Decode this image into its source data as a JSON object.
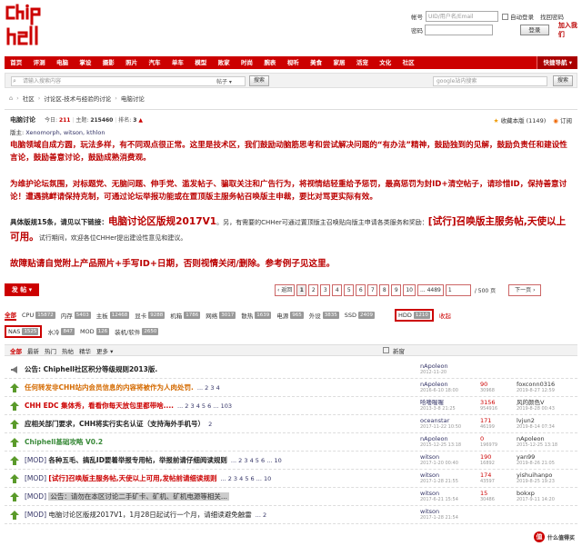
{
  "header": {
    "login": {
      "account_label": "帐号",
      "account_placeholder": "UID/用户名/Email",
      "autologin": "自动登录",
      "password_label": "密码",
      "retrieve": "找回密码",
      "login_button": "登录",
      "join": "加入我们"
    }
  },
  "nav": {
    "items": [
      "首页",
      "评测",
      "电脑",
      "掌设",
      "摄影",
      "照片",
      "汽车",
      "单车",
      "模型",
      "败家",
      "时尚",
      "腕表",
      "视听",
      "美食",
      "家居",
      "活宠",
      "文化",
      "社区"
    ],
    "quick": "快捷导航 ▾"
  },
  "search": {
    "placeholder": "请输入搜索内容",
    "type": "帖子 ▾",
    "button": "搜索",
    "google_placeholder": "google站内搜索",
    "google_button": "搜索"
  },
  "breadcrumb": [
    "社区",
    "讨论区-技术与经验的讨论",
    "电脑讨论"
  ],
  "forum": {
    "title": "电脑讨论",
    "today_label": "今日:",
    "today": "211",
    "theme_label": "主题:",
    "theme": "215460",
    "rank_label": "排名:",
    "rank": "3",
    "mods_label": "版主:",
    "mods": "Xenomorph, witson, kthlon",
    "favorite": "收藏本版 (1149)",
    "subscribe": "订阅",
    "rules": {
      "p1": "电脑领域自成方圆，玩法多样，有不同观点很正常。这里是技术区，我们鼓励动脑筋思考和尝试解决问题的“有办法”精神，鼓励独到的见解，鼓励负责任和建设性言论，鼓励善意讨论，鼓励成熟消费观。",
      "p2": "为维护论坛氛围，对标题党、无脑问题、伸手党、滥发帖子、骗取关注和广告行为，将视情结轻重给予惩罚，最高惩罚为封ID+清空帖子，请珍惜ID，保持善意讨论！遭遇挑衅请保持克制，可通过论坛举报功能或在置顶版主服务帖召唤版主申裁，要比对骂更实际有效。",
      "p3_lead": "具体版规15条，请见以下链接：",
      "p3_link": "电脑讨论区版规2017V1",
      "p3_mid": "。另，有需要的CHHer可通过置顶版主召唤贴向版主申请各类服务和奖励：",
      "p3_call": "[试行]召唤版主服务帖,天使以上可用。",
      "p3_tail": "试行期间，欢迎各位CHHer提出建设性意见和建议。",
      "p4": "故障贴请自觉附上产品照片+手写ID+日期，否则视情关闭/删除。参考例子见这里。"
    }
  },
  "pager": {
    "post_button": "发 帖 ▾",
    "prev": "‹ 返回",
    "pages": [
      "1",
      "2",
      "3",
      "4",
      "5",
      "6",
      "7",
      "8",
      "9",
      "10"
    ],
    "ellipsis": "... 4489",
    "input": "1",
    "total": "/ 500 页",
    "next": "下一页 ›"
  },
  "tags": {
    "row1": [
      {
        "name": "全部",
        "count": ""
      },
      {
        "name": "CPU",
        "count": "15872"
      },
      {
        "name": "内存",
        "count": "5403"
      },
      {
        "name": "主板",
        "count": "12468"
      },
      {
        "name": "显卡",
        "count": "9288"
      },
      {
        "name": "机箱",
        "count": "1786"
      },
      {
        "name": "网络",
        "count": "3017"
      },
      {
        "name": "散热",
        "count": "1639"
      },
      {
        "name": "电源",
        "count": "965"
      },
      {
        "name": "外设",
        "count": "3835"
      },
      {
        "name": "SSD",
        "count": "2409"
      }
    ],
    "hdd": {
      "name": "HDD",
      "count": "1210"
    },
    "fold": "收起",
    "nas": {
      "name": "NAS",
      "count": "1525"
    },
    "row2": [
      {
        "name": "水冷",
        "count": "847"
      },
      {
        "name": "MOD",
        "count": "126"
      },
      {
        "name": "装机/软件",
        "count": "2650"
      }
    ]
  },
  "filter": {
    "items": [
      "全部",
      "最新",
      "热门",
      "热帖",
      "精华",
      "更多 ▾"
    ],
    "new_window": "新窗"
  },
  "threads": [
    {
      "icon": "announce",
      "prefix": "",
      "title": "公告: Chiphell社区积分等级规则2013版.",
      "style": "dark",
      "pages": "",
      "author": "nApoleon",
      "author_date": "2012-11-20",
      "replies": "",
      "views": "",
      "last": "",
      "last_date": ""
    },
    {
      "icon": "pin",
      "prefix": "",
      "title": "任何转发非CHH站内会员信息的内容将被作为人肉处罚.",
      "style": "org",
      "pages": "... 2 3 4",
      "author": "nApoleon",
      "author_date": "2016-6-10 18:00",
      "replies": "90",
      "views": "30968",
      "last": "foxconn0316",
      "last_date": "2019-8-27 12:59"
    },
    {
      "icon": "pin",
      "prefix": "",
      "title": "CHH EDC 集体秀，看看你每天放包里都带啥....",
      "style": "red",
      "pages": "... 2 3 4 5 6 ... 103",
      "author": "哈喽喔喔",
      "author_date": "2013-3-8 21:25",
      "replies": "3156",
      "views": "954916",
      "last": "风的颜色V",
      "last_date": "2019-8-28 00:43"
    },
    {
      "icon": "pin",
      "prefix": "",
      "title": "应相关部门要求，CHH将实行实名认证（支持海外手机号）",
      "style": "dark",
      "pages": "2",
      "author": "oceanstar",
      "author_date": "2017-11-22 10:50",
      "replies": "171",
      "views": "46199",
      "last": "lvjun2",
      "last_date": "2019-8-14 07:34"
    },
    {
      "icon": "pin",
      "prefix": "",
      "title": "Chiphell基础攻略 V0.2",
      "style": "grn",
      "pages": "",
      "author": "nApoleon",
      "author_date": "2015-12-25 13:18",
      "replies": "0",
      "views": "196979",
      "last": "nApoleon",
      "last_date": "2015-12-25 13:18"
    },
    {
      "icon": "pin",
      "prefix": "[MOD]",
      "title": "各种五毛、搞乱ID要着举报专用帖，举报前请仔细阅读规则",
      "style": "dark",
      "pages": "... 2 3 4 5 6 ... 10",
      "author": "witson",
      "author_date": "2017-1-20 00:40",
      "replies": "190",
      "views": "16892",
      "last": "yan99",
      "last_date": "2019-8-26 21:05"
    },
    {
      "icon": "pin",
      "prefix": "[MOD]",
      "title": "[试行]召唤版主服务帖,天使以上可用,发帖前请细读规则",
      "style": "red",
      "pages": "... 2 3 4 5 6 ... 10",
      "author": "witson",
      "author_date": "2017-1-28 21:55",
      "replies": "174",
      "views": "43597",
      "last": "yishuihanpo",
      "last_date": "2019-8-25 19:23"
    },
    {
      "icon": "pin",
      "prefix": "[MOD]",
      "title": "公告：请勿在本区讨论二手矿卡、矿机、矿机电源等相关...",
      "style": "grey",
      "pages": "",
      "author": "witson",
      "author_date": "2017-6-21 15:54",
      "replies": "15",
      "views": "30486",
      "last": "bokxp",
      "last_date": "2017-9-11 14:20"
    },
    {
      "icon": "pin",
      "prefix": "[MOD]",
      "title": "电脑讨论区版规2017V1，1月28日起试行一个月，请细读避免触雷",
      "style": "norm",
      "pages": "... 2",
      "author": "witson",
      "author_date": "2017-1-28 21:54",
      "replies": "",
      "views": "",
      "last": "",
      "last_date": ""
    }
  ],
  "watermark": "什么值得买"
}
